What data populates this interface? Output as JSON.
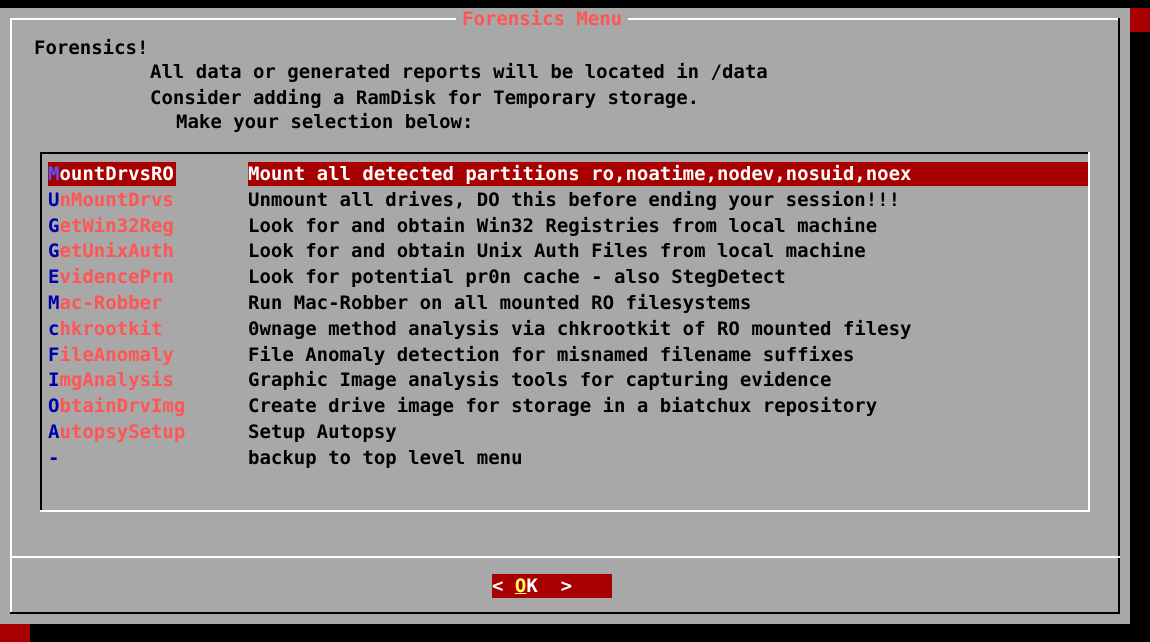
{
  "dialog": {
    "title": "Forensics Menu"
  },
  "intro": {
    "line1": "Forensics!",
    "line2": "All data or generated reports will be located in /data",
    "line3": "Consider adding a RamDisk for Temporary storage.",
    "line4": "Make your selection below:"
  },
  "menu": {
    "selected_index": 0,
    "items": [
      {
        "hot": "M",
        "rest": "ountDrvsRO",
        "desc": "Mount all detected partitions ro,noatime,nodev,nosuid,noex"
      },
      {
        "hot": "U",
        "rest": "nMountDrvs",
        "desc": "Unmount all drives, DO this before ending your session!!!"
      },
      {
        "hot": "G",
        "rest": "etWin32Reg",
        "desc": "Look for and obtain Win32 Registries from local machine"
      },
      {
        "hot": "G",
        "rest": "etUnixAuth",
        "desc": "Look for and obtain Unix Auth Files from local machine"
      },
      {
        "hot": "E",
        "rest": "videncePrn",
        "desc": "Look for potential pr0n cache - also StegDetect"
      },
      {
        "hot": "M",
        "rest": "ac-Robber",
        "desc": "Run Mac-Robber on all mounted RO filesystems"
      },
      {
        "hot": "c",
        "rest": "hkrootkit",
        "desc": "0wnage method analysis via chkrootkit of RO mounted filesy"
      },
      {
        "hot": "F",
        "rest": "ileAnomaly",
        "desc": "File Anomaly detection for misnamed filename suffixes"
      },
      {
        "hot": "I",
        "rest": "mgAnalysis",
        "desc": "Graphic Image analysis tools for capturing evidence"
      },
      {
        "hot": "O",
        "rest": "btainDrvImg",
        "desc": "Create drive image for storage in a biatchux repository"
      },
      {
        "hot": "A",
        "rest": "utopsySetup",
        "desc": "Setup Autopsy"
      },
      {
        "hot": "-",
        "rest": "",
        "desc": "backup to top level menu"
      }
    ]
  },
  "buttons": {
    "ok_left": "< ",
    "ok_hot": "O",
    "ok_rest": "K",
    "ok_right": "  >"
  },
  "colors": {
    "dialog_bg": "#a8a8a8",
    "selection_bg": "#a80000",
    "tag_text": "#ff5555",
    "hotkey": "#0000aa"
  }
}
